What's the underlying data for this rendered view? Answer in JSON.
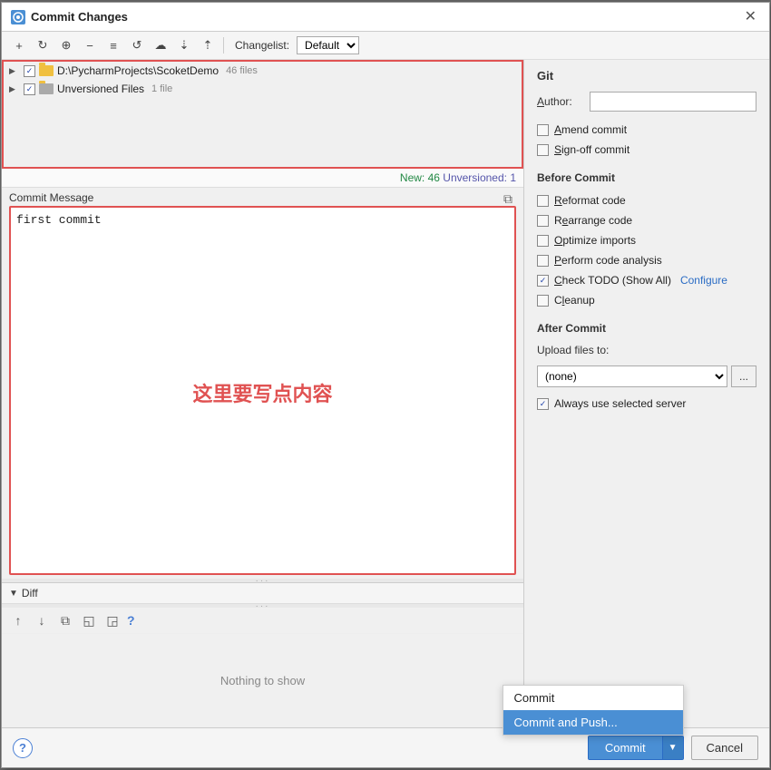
{
  "dialog": {
    "title": "Commit Changes",
    "icon_label": "C"
  },
  "toolbar": {
    "changelist_label": "Changelist:",
    "changelist_value": "Default",
    "buttons": [
      "↩",
      "↻",
      "+",
      "⊕",
      "−",
      "≡",
      "↺",
      "☁",
      "⇣",
      "⇡"
    ]
  },
  "file_tree": {
    "items": [
      {
        "name": "D:\\PycharmProjects\\ScoketDemo",
        "count": "46 files",
        "checked": true,
        "expanded": false,
        "type": "folder"
      },
      {
        "name": "Unversioned Files",
        "count": "1 file",
        "checked": true,
        "expanded": false,
        "type": "folder"
      }
    ]
  },
  "status_bar": {
    "new_label": "New: 46",
    "unversioned_label": "Unversioned: 1"
  },
  "commit_message": {
    "label": "Commit Message",
    "value": "first commit",
    "hint_text": "这里要写点内容"
  },
  "diff_section": {
    "label": "Diff",
    "nothing_to_show": "Nothing to show"
  },
  "git_panel": {
    "section_title": "Git",
    "author_label": "Author:",
    "author_placeholder": "",
    "options": [
      {
        "label": "Amend commit",
        "checked": false,
        "underline_char": "A"
      },
      {
        "label": "Sign-off commit",
        "checked": false,
        "underline_char": "S"
      }
    ],
    "before_commit_title": "Before Commit",
    "before_commit_options": [
      {
        "label": "Reformat code",
        "checked": false,
        "underline_char": "R"
      },
      {
        "label": "Rearrange code",
        "checked": false,
        "underline_char": "e"
      },
      {
        "label": "Optimize imports",
        "checked": false,
        "underline_char": "O"
      },
      {
        "label": "Perform code analysis",
        "checked": false,
        "underline_char": "P"
      },
      {
        "label": "Check TODO (Show All)",
        "checked": true,
        "underline_char": "C",
        "has_configure": true
      },
      {
        "label": "Cleanup",
        "checked": false,
        "underline_char": "l"
      }
    ],
    "configure_link": "Configure",
    "after_commit_title": "After Commit",
    "upload_label": "Upload files to:",
    "upload_options": [
      "(none)"
    ],
    "upload_selected": "(none)",
    "always_use_server_label": "Always use selected server",
    "always_use_server_checked": true
  },
  "footer": {
    "help_label": "?",
    "commit_label": "Commit",
    "commit_dropdown_arrow": "▼",
    "cancel_label": "Cancel",
    "dropdown_items": [
      {
        "label": "Commit",
        "active": false
      },
      {
        "label": "Commit and Push...",
        "active": true
      }
    ]
  }
}
